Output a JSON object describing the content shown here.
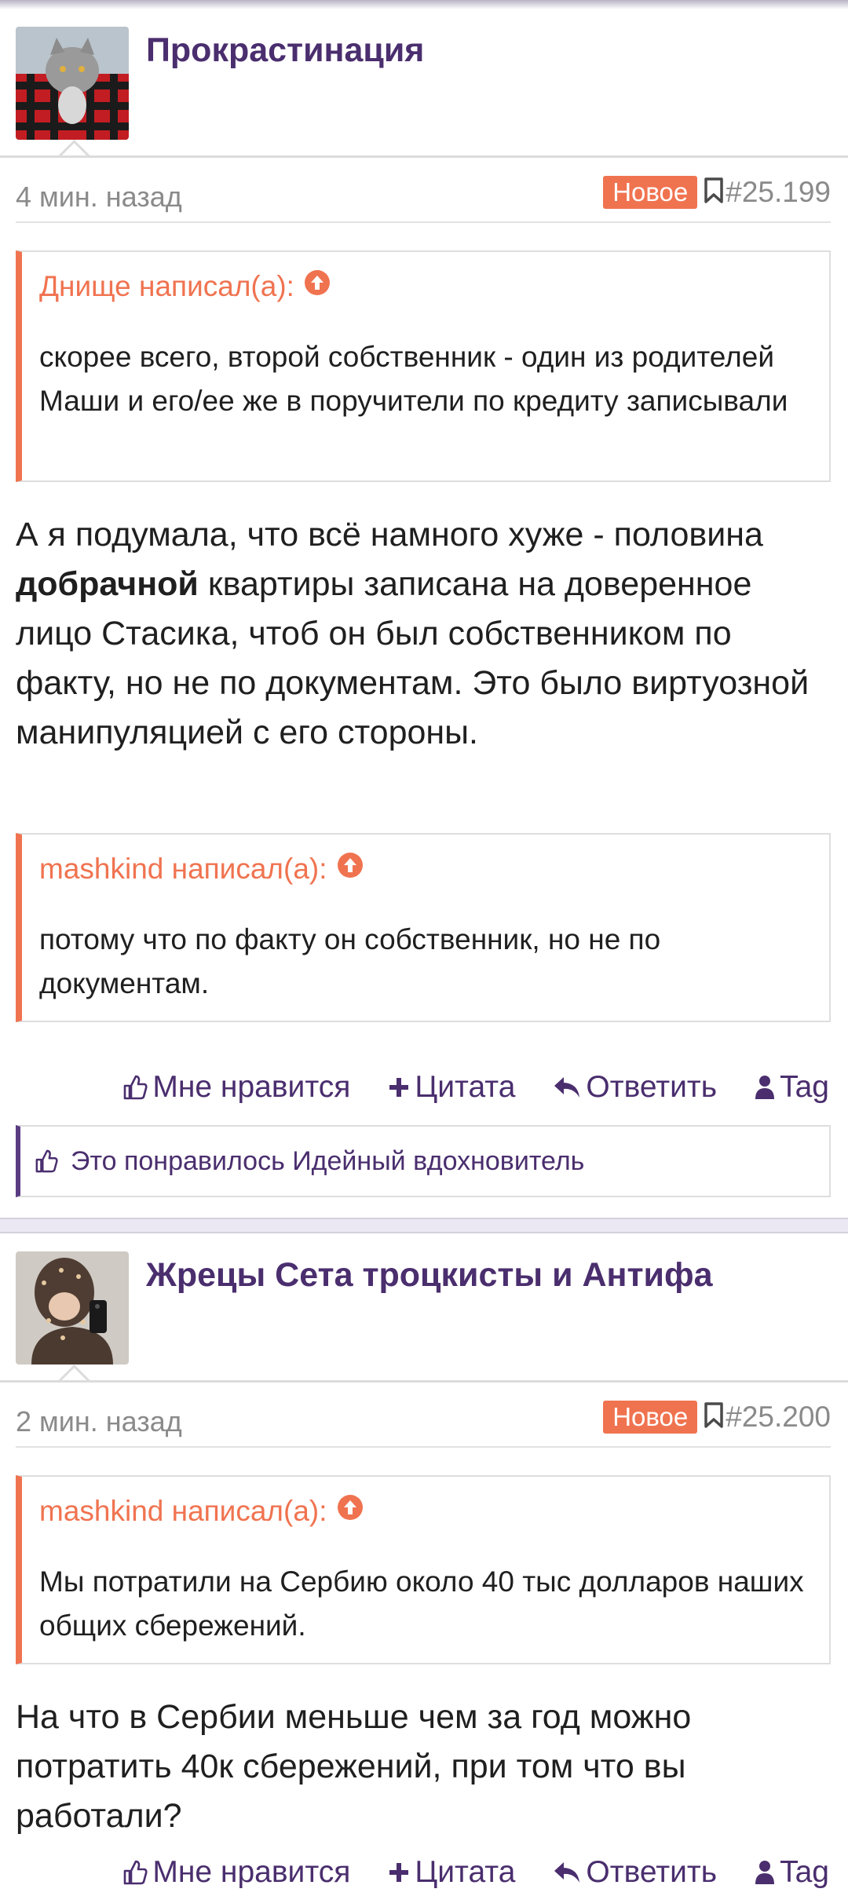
{
  "posts": [
    {
      "username": "Прокрастинация",
      "time": "4 мин. назад",
      "badge": "Новое",
      "post_number": "#25.199",
      "quotes": [
        {
          "author": "Днище написал(а):",
          "text": "скорее всего, второй собственник - один из родителей Маши и его/ее же в поручители по кредиту записывали"
        }
      ],
      "body_plain_1": "А я подумала, что всё намного хуже - половина",
      "body_bold": "добрачной",
      "body_plain_2": "квартиры записана на доверенное лицо Стасика, чтоб он был собственником по факту, но не по документам. Это было виртуозной манипуляцией с его стороны.",
      "quotes2": [
        {
          "author": "mashkind написал(а):",
          "text": "потому что по факту он собственник, но не по документам."
        }
      ],
      "actions": {
        "like": "Мне нравится",
        "quote": "Цитата",
        "reply": "Ответить",
        "tag": "Tag"
      },
      "liked_by": "Это понравилось Идейный вдохновитель"
    },
    {
      "username": "Жрецы Сета троцкисты и Антифа",
      "time": "2 мин. назад",
      "badge": "Новое",
      "post_number": "#25.200",
      "quotes": [
        {
          "author": "mashkind написал(а):",
          "text": "Мы потратили на Сербию около 40 тыс долларов наших общих сбережений."
        }
      ],
      "body": "На что в Сербии меньше чем за год можно потратить 40к сбережений, при том что вы работали?",
      "actions": {
        "like": "Мне нравится",
        "quote": "Цитата",
        "reply": "Ответить",
        "tag": "Tag"
      }
    }
  ],
  "colors": {
    "accent": "#f07350",
    "brand": "#4a2e6e",
    "separator": "#ece8f3"
  }
}
